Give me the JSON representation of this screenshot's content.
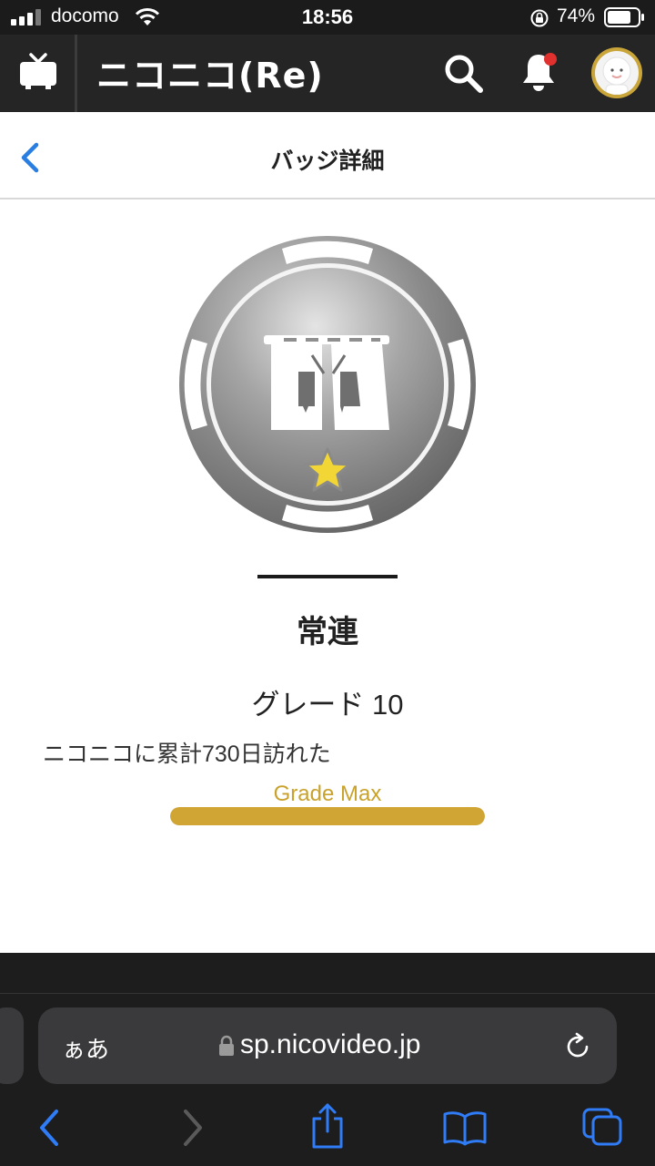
{
  "status_bar": {
    "carrier": "docomo",
    "time": "18:56",
    "battery_percent": "74%"
  },
  "app_header": {
    "logo_text": "ニコニコ(Re)",
    "icons": [
      "tv-icon",
      "search-icon",
      "bell-icon",
      "avatar"
    ],
    "notification_dot_color": "#e0312f"
  },
  "page": {
    "title": "バッジ詳細"
  },
  "badge": {
    "icon": "noren-curtain-icon",
    "name": "常連",
    "grade_label": "グレード 10",
    "description": "ニコニコに累計730日訪れた",
    "progress_label": "Grade Max",
    "progress_fraction": 1.0,
    "star_color": "#f2d635",
    "progress_color": "#d1a534"
  },
  "browser": {
    "text_size_button": "ぁあ",
    "url": "sp.nicovideo.jp",
    "toolbar_icons": [
      "back-icon",
      "forward-icon",
      "share-icon",
      "bookmarks-icon",
      "tabs-icon"
    ]
  }
}
